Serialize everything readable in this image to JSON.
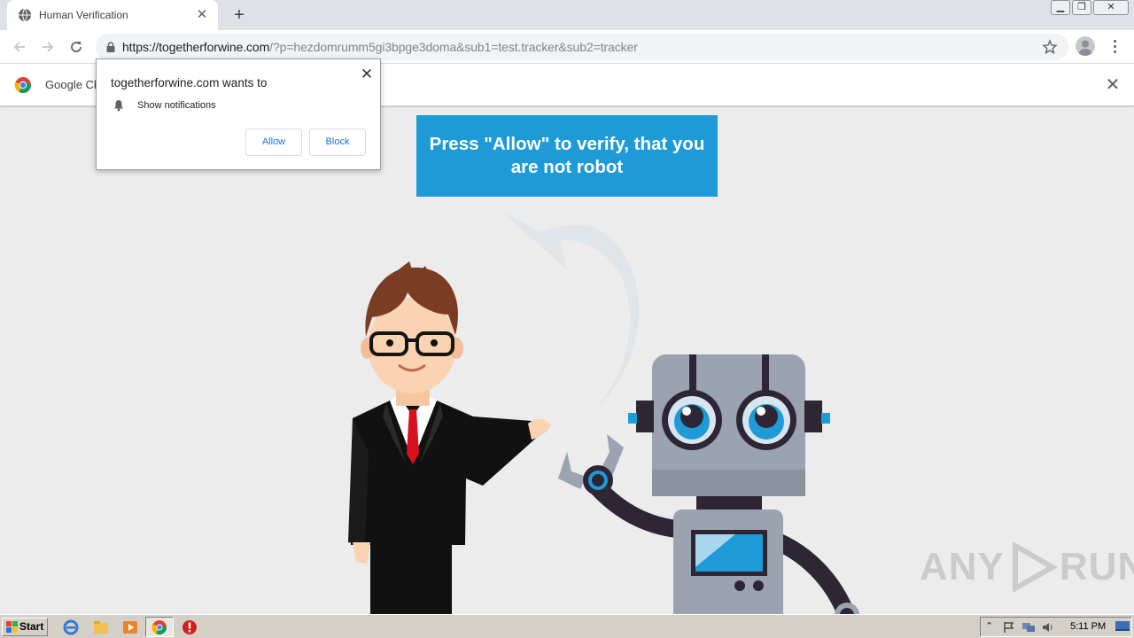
{
  "tab": {
    "title": "Human Verification"
  },
  "address": {
    "host": "https://togetherforwine.com",
    "path": "/?p=hezdomrumm5gi3bpge3doma&sub1=test.tracker&sub2=tracker"
  },
  "infobar": {
    "text": "Google Ch"
  },
  "permission": {
    "title": "togetherforwine.com wants to",
    "item": "Show notifications",
    "allow": "Allow",
    "block": "Block"
  },
  "page": {
    "banner": "Press \"Allow\" to verify, that you are not robot"
  },
  "watermark": {
    "left": "ANY",
    "right": "RUN"
  },
  "taskbar": {
    "start": "Start",
    "clock": "5:11 PM"
  },
  "colors": {
    "banner": "#1e9bd7",
    "background": "#ececec",
    "accent": "#1a73e8"
  }
}
